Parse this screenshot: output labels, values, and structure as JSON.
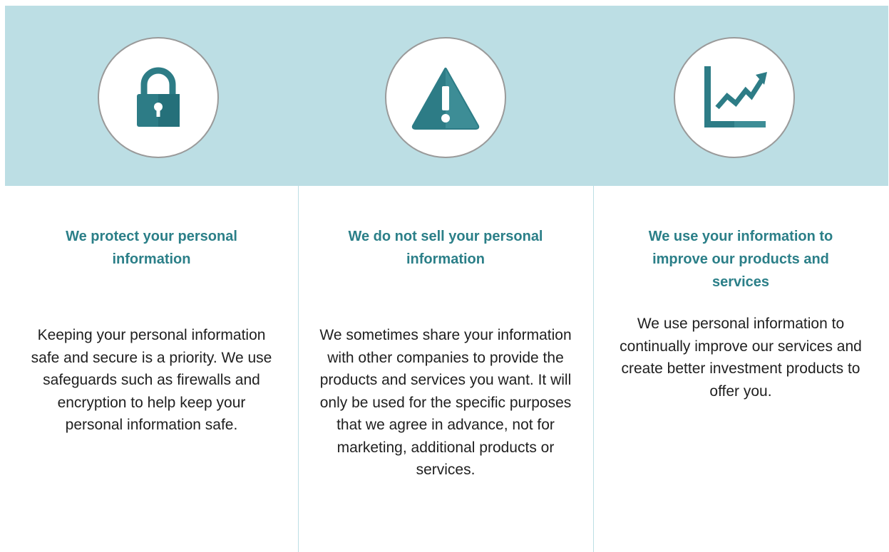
{
  "colors": {
    "banner": "#bcdee4",
    "accent": "#2b7f88",
    "icon": "#2d7c86",
    "text": "#1f1f1f"
  },
  "columns": [
    {
      "icon": "padlock-icon",
      "heading": "We protect your personal information",
      "body": "Keeping your personal information safe and secure is a priority. We use safeguards such as firewalls and encryption to help keep your personal information safe."
    },
    {
      "icon": "warning-icon",
      "heading": "We do not sell your personal information",
      "body": "We sometimes share your information with other companies to provide the products and services you want. It will only be used for the specific purposes that we agree in advance, not for marketing, additional products or services."
    },
    {
      "icon": "growth-chart-icon",
      "heading": "We use your information to improve our products and services",
      "body": "We use personal information to continually improve our services and create better investment products to offer you."
    }
  ]
}
